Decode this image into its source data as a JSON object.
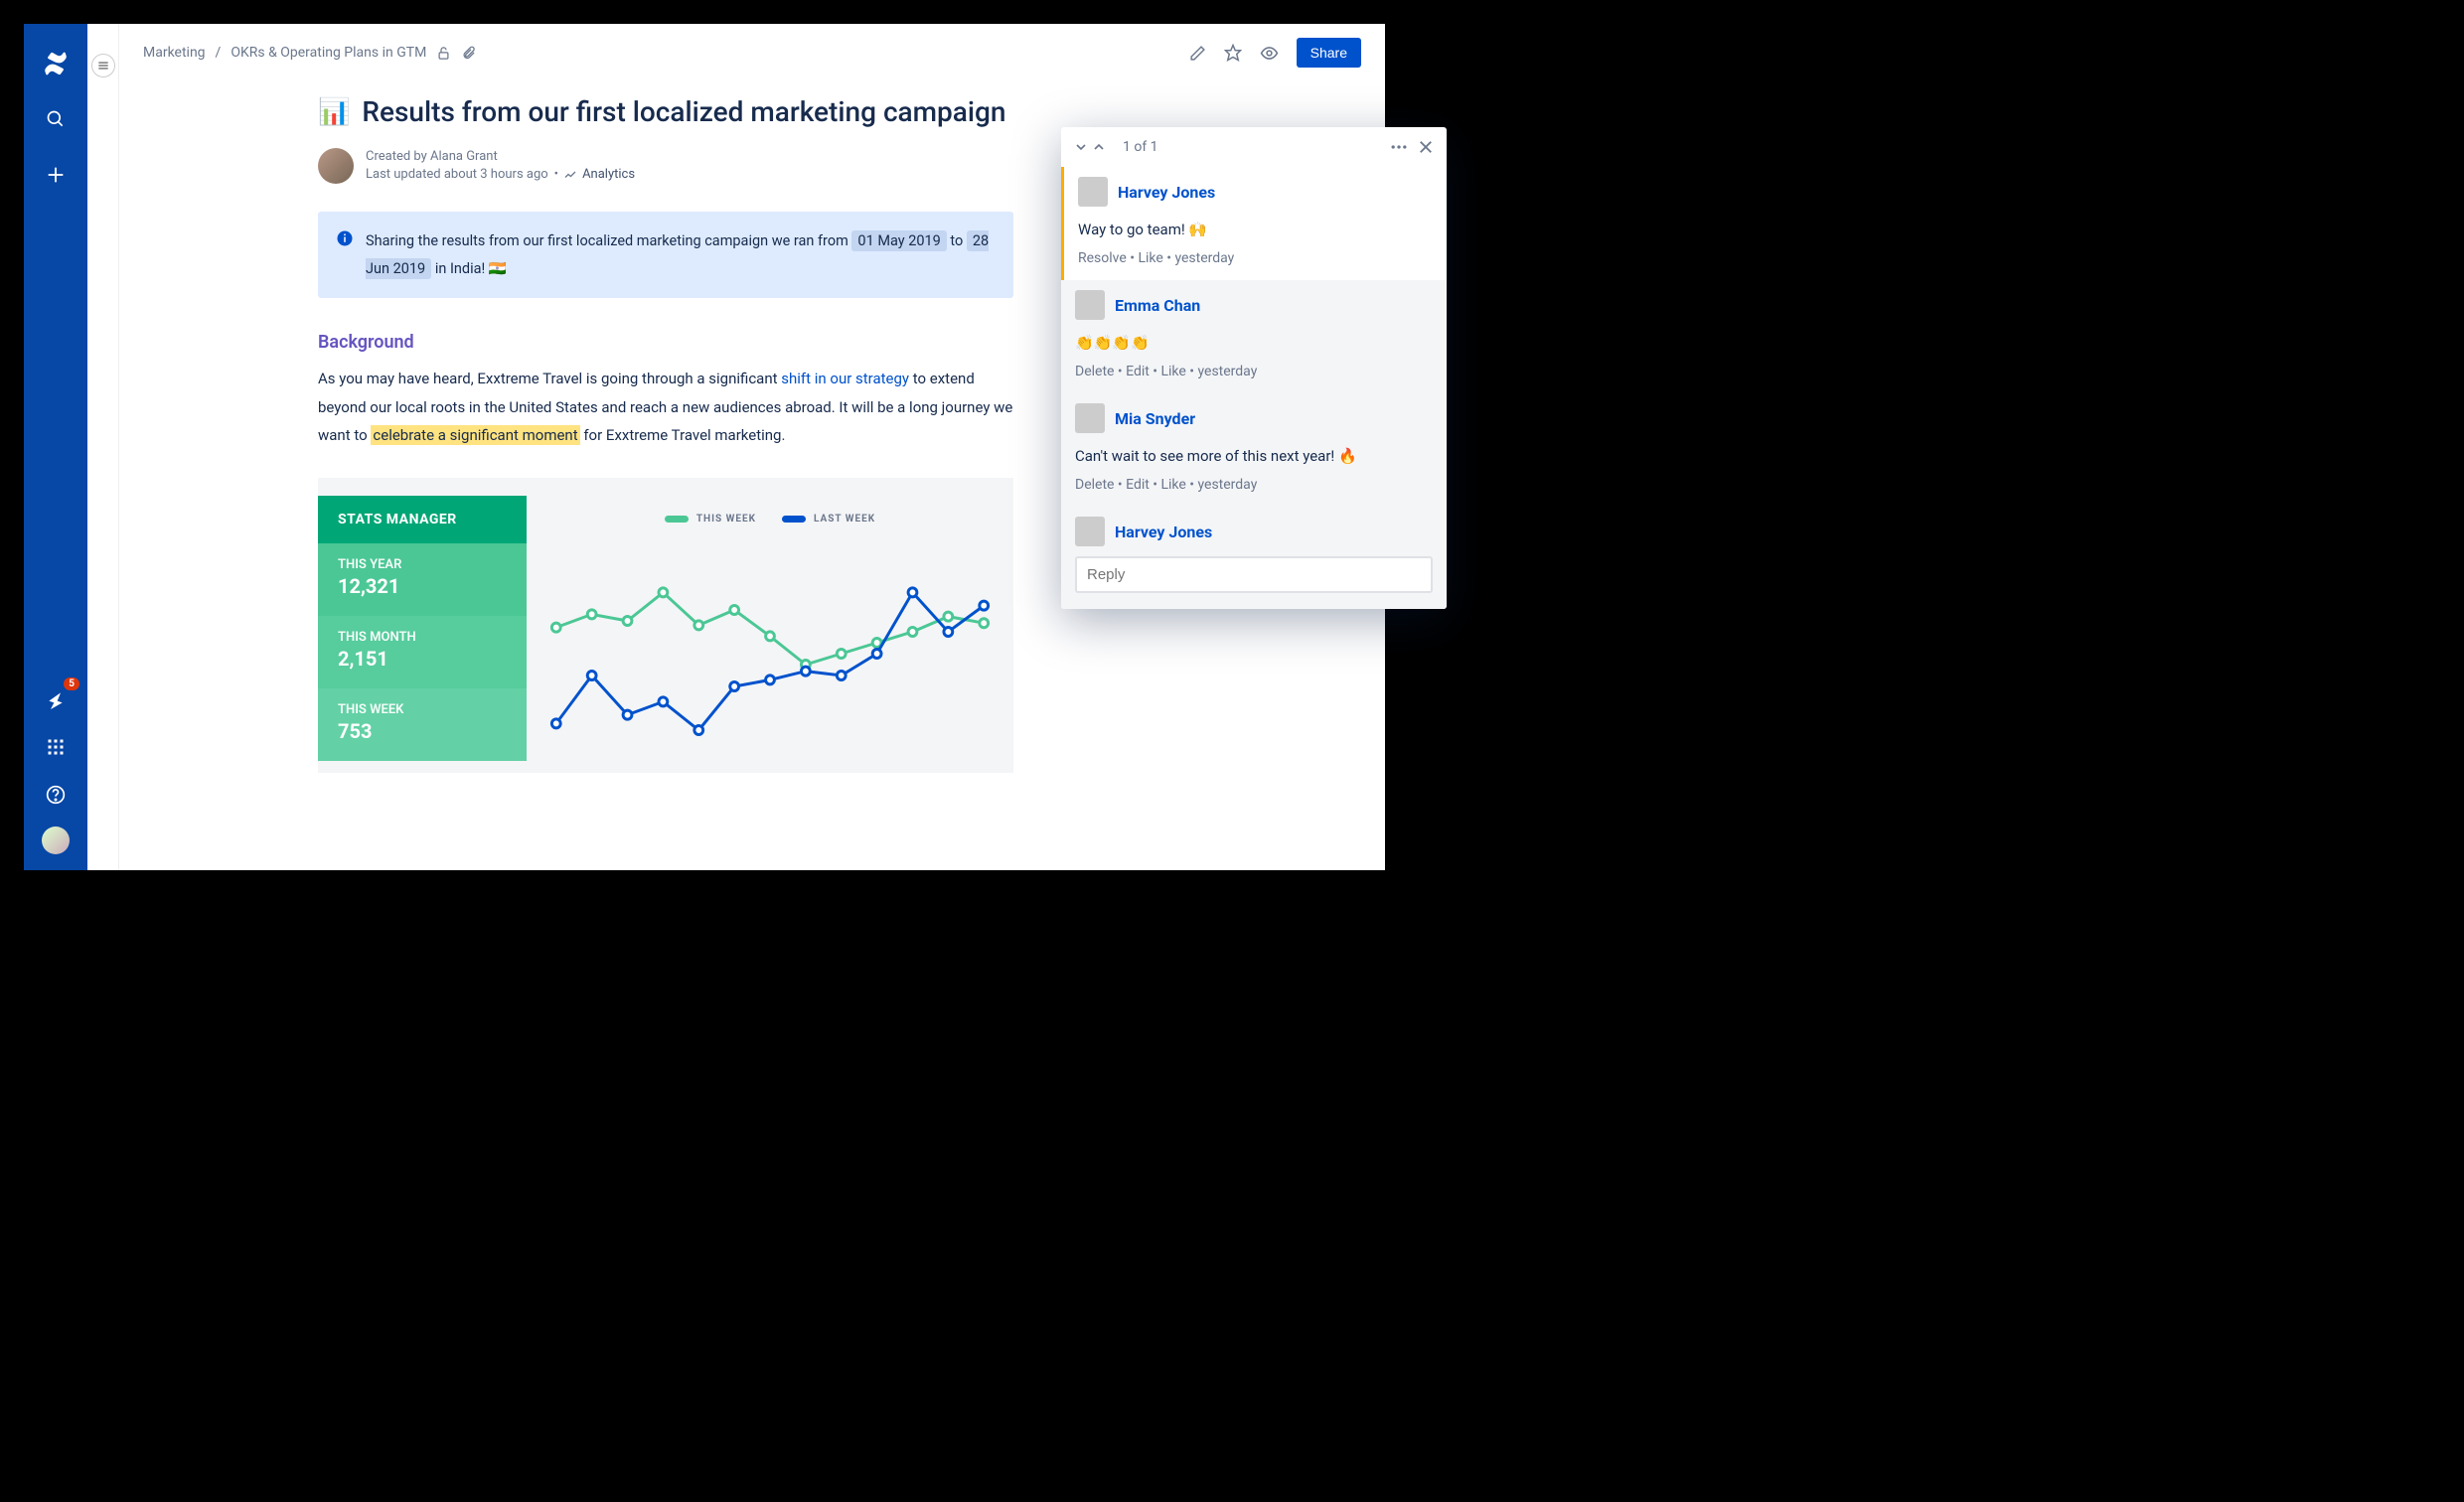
{
  "nav": {
    "notif_count": "5"
  },
  "breadcrumbs": {
    "root": "Marketing",
    "page": "OKRs & Operating Plans in GTM"
  },
  "actions": {
    "share": "Share"
  },
  "page": {
    "title_emoji": "📊",
    "title": "Results from our first localized marketing campaign",
    "created_by": "Created by Alana Grant",
    "updated": "Last updated about 3 hours ago",
    "analytics": "Analytics"
  },
  "info": {
    "pre": "Sharing the results from our first localized marketing campaign we ran from ",
    "date1": "01 May 2019",
    "mid": " to ",
    "date2": "28 Jun 2019",
    "post": " in India! 🇮🇳"
  },
  "section": {
    "background": "Background"
  },
  "body": {
    "p1a": "As you may have heard, Exxtreme Travel is going through a significant ",
    "p1link": "shift in our strategy",
    "p1b": " to extend beyond our local roots in the United States and reach a new audiences abroad. It will be a long journey we want to ",
    "p1hi": "celebrate a significant moment",
    "p1c": " for Exxtreme Travel marketing."
  },
  "chart_data": {
    "type": "line",
    "title": "STATS MANAGER",
    "stats": [
      {
        "label": "THIS YEAR",
        "value": "12,321"
      },
      {
        "label": "THIS MONTH",
        "value": "2,151"
      },
      {
        "label": "THIS WEEK",
        "value": "753"
      }
    ],
    "legend": [
      {
        "name": "THIS WEEK",
        "color": "#4BC795"
      },
      {
        "name": "LAST WEEK",
        "color": "#0052CC"
      }
    ],
    "x": [
      1,
      2,
      3,
      4,
      5,
      6,
      7,
      8,
      9,
      10,
      11,
      12,
      13
    ],
    "series": [
      {
        "name": "THIS WEEK",
        "color": "#4BC795",
        "values": [
          62,
          68,
          65,
          78,
          63,
          70,
          58,
          45,
          50,
          55,
          60,
          67,
          64
        ]
      },
      {
        "name": "LAST WEEK",
        "color": "#0052CC",
        "values": [
          18,
          40,
          22,
          28,
          15,
          35,
          38,
          42,
          40,
          50,
          78,
          60,
          72
        ]
      }
    ],
    "ylim": [
      0,
      100
    ]
  },
  "comments": {
    "count": "1 of 1",
    "thread": [
      {
        "name": "Harvey Jones",
        "body": "Way to go team! 🙌",
        "actions": "Resolve • Like • yesterday",
        "primary": true
      },
      {
        "name": "Emma Chan",
        "body": "👏👏👏👏",
        "actions": "Delete • Edit • Like • yesterday",
        "primary": false
      },
      {
        "name": "Mia Snyder",
        "body": "Can't wait to see more of this next year! 🔥",
        "actions": "Delete • Edit • Like • yesterday",
        "primary": false
      }
    ],
    "reply_author": "Harvey Jones",
    "reply_placeholder": "Reply"
  }
}
